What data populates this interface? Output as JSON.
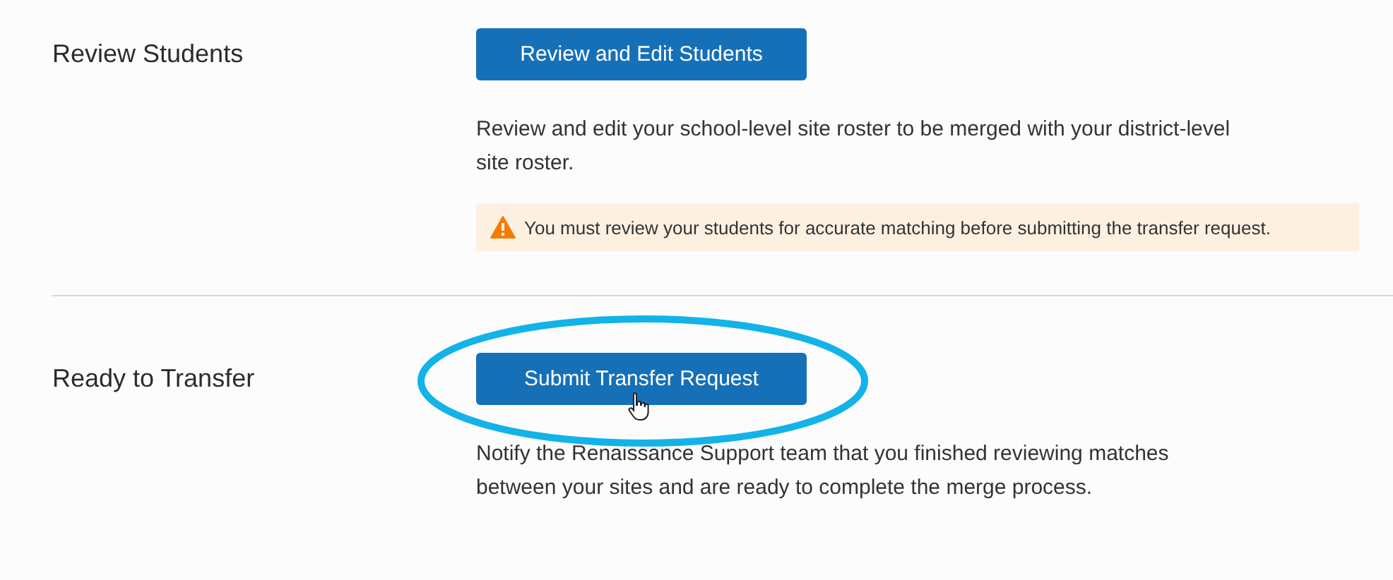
{
  "sections": [
    {
      "label": "Review Students",
      "button": "Review and Edit Students",
      "description": "Review and edit your school-level site roster to be merged with your district-level site roster.",
      "warning": "You must review your students for accurate matching before submitting the transfer request.",
      "highlighted": false
    },
    {
      "label": "Ready to Transfer",
      "button": "Submit Transfer Request",
      "description": "Notify the Renaissance Support team that you finished reviewing matches between your sites and are ready to complete the merge process.",
      "highlighted": true
    }
  ]
}
